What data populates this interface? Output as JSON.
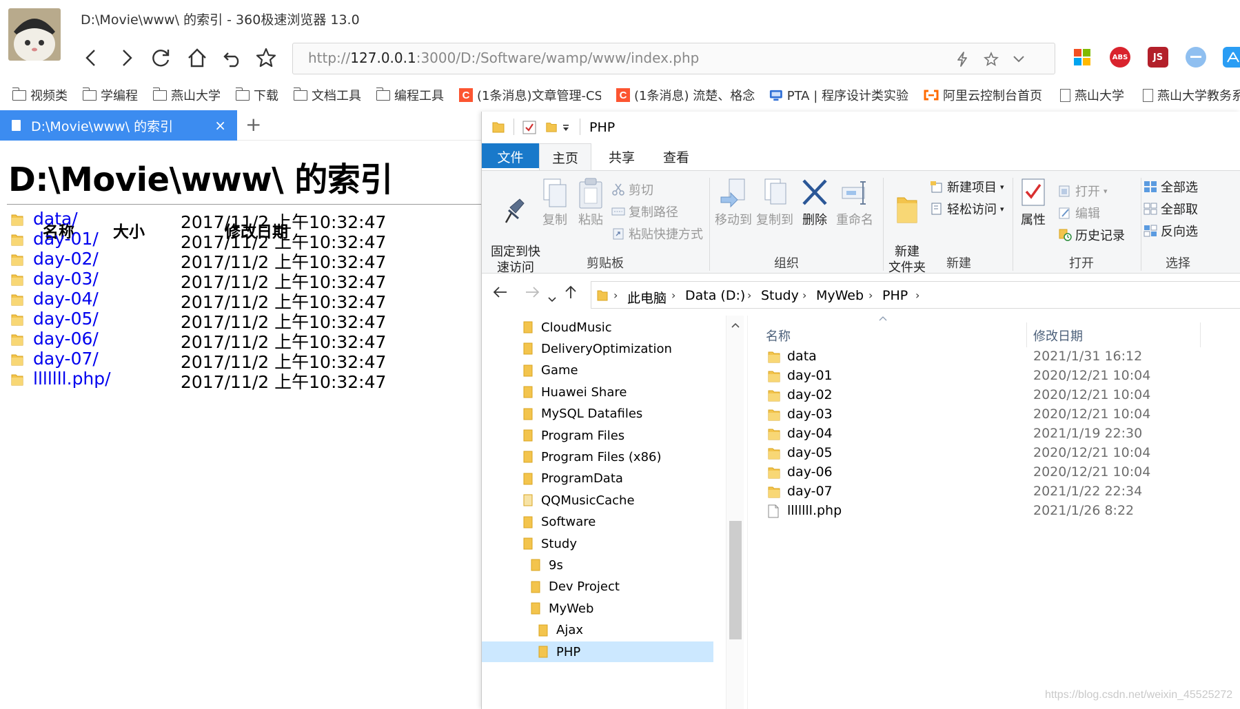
{
  "browser": {
    "window_title": "D:\\Movie\\www\\ 的索引 - 360极速浏览器 13.0",
    "url_scheme": "http://",
    "url_host": "127.0.0.1",
    "url_rest": ":3000/D:/Software/wamp/www/index.php",
    "bookmarks": [
      {
        "label": "视频类",
        "icon": "folder-icon"
      },
      {
        "label": "学编程",
        "icon": "folder-icon"
      },
      {
        "label": "燕山大学",
        "icon": "folder-icon"
      },
      {
        "label": "下载",
        "icon": "folder-icon"
      },
      {
        "label": "文档工具",
        "icon": "folder-icon"
      },
      {
        "label": "编程工具",
        "icon": "folder-icon"
      },
      {
        "label": "(1条消息)文章管理-CS",
        "icon": "csdn-icon"
      },
      {
        "label": "(1条消息) 流楚、格念",
        "icon": "csdn-icon"
      },
      {
        "label": "PTA | 程序设计类实验",
        "icon": "pta-icon"
      },
      {
        "label": "阿里云控制台首页",
        "icon": "aliyun-icon"
      },
      {
        "label": "燕山大学",
        "icon": "page-icon"
      },
      {
        "label": "燕山大学教务系",
        "icon": "page-icon"
      }
    ],
    "csdn_glyph": "C",
    "ext_labels": {
      "abs": "ABS",
      "js": "JS"
    },
    "tab": {
      "title": "D:\\Movie\\www\\ 的索引",
      "close": "×"
    },
    "new_tab": "+"
  },
  "page": {
    "heading": "D:\\Movie\\www\\ 的索引",
    "columns": {
      "name": "名称",
      "size": "大小",
      "modified": "修改日期"
    },
    "rows": [
      {
        "name": "data/",
        "date": "2017/11/2 上午10:32:47"
      },
      {
        "name": "day-01/",
        "date": "2017/11/2 上午10:32:47"
      },
      {
        "name": "day-02/",
        "date": "2017/11/2 上午10:32:47"
      },
      {
        "name": "day-03/",
        "date": "2017/11/2 上午10:32:47"
      },
      {
        "name": "day-04/",
        "date": "2017/11/2 上午10:32:47"
      },
      {
        "name": "day-05/",
        "date": "2017/11/2 上午10:32:47"
      },
      {
        "name": "day-06/",
        "date": "2017/11/2 上午10:32:47"
      },
      {
        "name": "day-07/",
        "date": "2017/11/2 上午10:32:47"
      },
      {
        "name": "lllllll.php/",
        "date": "2017/11/2 上午10:32:47"
      }
    ]
  },
  "explorer": {
    "title": "PHP",
    "ribbon_tabs": {
      "file": "文件",
      "home": "主页",
      "share": "共享",
      "view": "查看"
    },
    "ribbon": {
      "pin": "固定到快\n速访问",
      "copy": "复制",
      "paste": "粘贴",
      "cut": "剪切",
      "copy_path": "复制路径",
      "paste_shortcut": "粘贴快捷方式",
      "clipboard": "剪贴板",
      "move_to": "移动到",
      "copy_to": "复制到",
      "delete": "删除",
      "rename": "重命名",
      "organize": "组织",
      "new_folder": "新建\n文件夹",
      "new_item": "新建项目",
      "easy_access": "轻松访问",
      "new_group": "新建",
      "properties": "属性",
      "open": "打开",
      "edit": "编辑",
      "history": "历史记录",
      "open_group": "打开",
      "select_all": "全部选",
      "select_none": "全部取",
      "invert": "反向选",
      "select_group": "选择"
    },
    "breadcrumb": [
      "此电脑",
      "Data (D:)",
      "Study",
      "MyWeb",
      "PHP"
    ],
    "tree": [
      {
        "label": "CloudMusic",
        "indent": 0
      },
      {
        "label": "DeliveryOptimization",
        "indent": 0
      },
      {
        "label": "Game",
        "indent": 0
      },
      {
        "label": "Huawei Share",
        "indent": 0
      },
      {
        "label": "MySQL Datafiles",
        "indent": 0
      },
      {
        "label": "Program Files",
        "indent": 0
      },
      {
        "label": "Program Files (x86)",
        "indent": 0
      },
      {
        "label": "ProgramData",
        "indent": 0
      },
      {
        "label": "QQMusicCache",
        "indent": 0
      },
      {
        "label": "Software",
        "indent": 0
      },
      {
        "label": "Study",
        "indent": 0
      },
      {
        "label": "9s",
        "indent": 1
      },
      {
        "label": "Dev Project",
        "indent": 1
      },
      {
        "label": "MyWeb",
        "indent": 1
      },
      {
        "label": "Ajax",
        "indent": 2
      },
      {
        "label": "PHP",
        "indent": 2,
        "selected": true
      }
    ],
    "columns": {
      "name": "名称",
      "modified": "修改日期"
    },
    "files": [
      {
        "name": "data",
        "date": "2021/1/31 16:12",
        "type": "folder"
      },
      {
        "name": "day-01",
        "date": "2020/12/21 10:04",
        "type": "folder"
      },
      {
        "name": "day-02",
        "date": "2020/12/21 10:04",
        "type": "folder"
      },
      {
        "name": "day-03",
        "date": "2020/12/21 10:04",
        "type": "folder"
      },
      {
        "name": "day-04",
        "date": "2021/1/19 22:30",
        "type": "folder"
      },
      {
        "name": "day-05",
        "date": "2020/12/21 10:04",
        "type": "folder"
      },
      {
        "name": "day-06",
        "date": "2020/12/21 10:04",
        "type": "folder"
      },
      {
        "name": "day-07",
        "date": "2021/1/22 22:34",
        "type": "folder"
      },
      {
        "name": "lllllll.php",
        "date": "2021/1/26 8:22",
        "type": "file"
      }
    ]
  },
  "watermark": "https://blog.csdn.net/weixin_45525272",
  "colors": {
    "tab_active": "#3c8cf0",
    "ribbon_file": "#1979ca",
    "link": "#0000ee",
    "folder": "#f3c44d",
    "selection": "#cce8ff"
  }
}
